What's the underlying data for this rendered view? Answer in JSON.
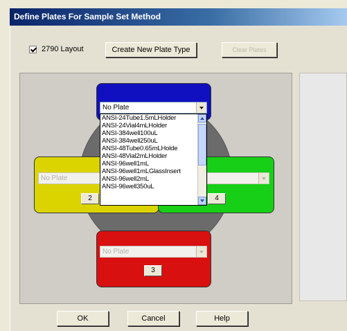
{
  "window": {
    "title": "Define Plates For Sample Set Method"
  },
  "layout_checkbox": {
    "label": "2790 Layout",
    "checked": true
  },
  "toolbar": {
    "create_label": "Create New Plate Type",
    "clear_label": "Clear Plates"
  },
  "plates": {
    "top": {
      "selected": "No Plate"
    },
    "left": {
      "selected": "No Plate",
      "number": "2"
    },
    "right": {
      "number": "4"
    },
    "bottom": {
      "selected": "No Plate",
      "number": "3"
    }
  },
  "dropdown": {
    "items": [
      "ANSI-24Tube1.5mLHolder",
      "ANSI-24Vial4mLHolder",
      "ANSI-384well100uL",
      "ANSI-384well250uL",
      "ANSI-48Tube0.65mLHolde",
      "ANSI-48Vial2mLHolder",
      "ANSI-96well1mL",
      "ANSI-96well1mLGlassInsert",
      "ANSI-96well2mL",
      "ANSI-96well350uL"
    ]
  },
  "footer": {
    "ok_label": "OK",
    "cancel_label": "Cancel",
    "help_label": "Help"
  },
  "colors": {
    "top_plate": "#1010c0",
    "left_plate": "#dcd400",
    "right_plate": "#17cf17",
    "bottom_plate": "#d81010"
  }
}
